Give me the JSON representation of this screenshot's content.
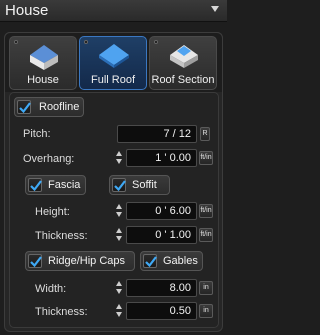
{
  "header": {
    "title": "House"
  },
  "tabs": [
    {
      "label": "House"
    },
    {
      "label": "Full Roof"
    },
    {
      "label": "Roof Section"
    }
  ],
  "roofline": {
    "label": "Roofline",
    "checked": true
  },
  "pitch": {
    "label": "Pitch:",
    "value": "7 / 12",
    "unit": "R"
  },
  "overhang": {
    "label": "Overhang:",
    "value": "1 ' 0.00",
    "unit": "ft/in"
  },
  "fascia": {
    "label": "Fascia",
    "checked": true
  },
  "soffit": {
    "label": "Soffit",
    "checked": true
  },
  "fascia_height": {
    "label": "Height:",
    "value": "0 ' 6.00",
    "unit": "ft/in"
  },
  "fascia_thickness": {
    "label": "Thickness:",
    "value": "0 ' 1.00",
    "unit": "ft/in"
  },
  "ridge_hip": {
    "label": "Ridge/Hip Caps",
    "checked": true
  },
  "gables": {
    "label": "Gables",
    "checked": true
  },
  "cap_width": {
    "label": "Width:",
    "value": "8.00",
    "unit": "in"
  },
  "cap_thickness": {
    "label": "Thickness:",
    "value": "0.50",
    "unit": "in"
  },
  "colors": {
    "accent": "#3b78c2",
    "check": "#3fa9f5",
    "background": "#1e1e1e"
  }
}
